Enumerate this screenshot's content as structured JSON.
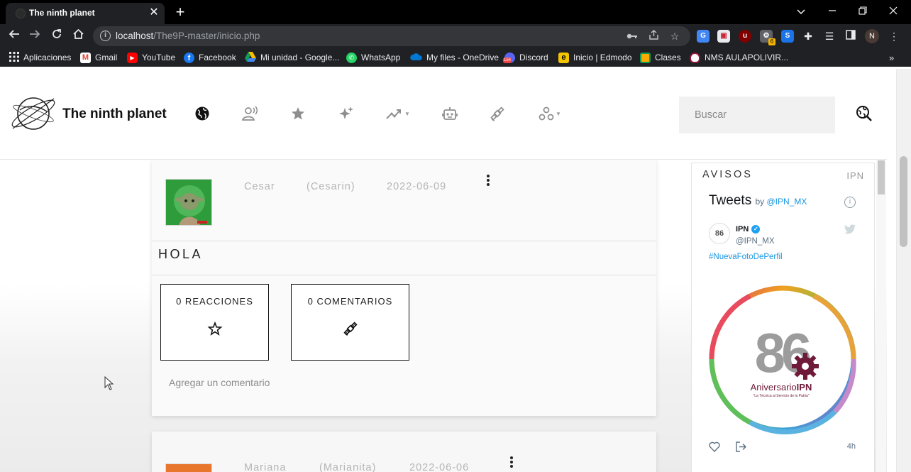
{
  "browser": {
    "tab_title": "The ninth planet",
    "url_host": "localhost",
    "url_path": "/The9P-master/inicio.php",
    "profile_initial": "N",
    "extension_badge": "6",
    "bookmarks": [
      {
        "label": "Aplicaciones",
        "icon": "apps-grid-icon",
        "color": "#e8eaed"
      },
      {
        "label": "Gmail",
        "icon": "gmail-icon",
        "color": "#ea4335"
      },
      {
        "label": "YouTube",
        "icon": "youtube-icon",
        "color": "#ff0000"
      },
      {
        "label": "Facebook",
        "icon": "facebook-icon",
        "color": "#1877f2"
      },
      {
        "label": "Mi unidad - Google...",
        "icon": "google-drive-icon",
        "color": "#fbbc04"
      },
      {
        "label": "WhatsApp",
        "icon": "whatsapp-icon",
        "color": "#25d366"
      },
      {
        "label": "My files - OneDrive",
        "icon": "onedrive-icon",
        "color": "#0078d4"
      },
      {
        "label": "Discord",
        "icon": "discord-icon",
        "color": "#5865f2",
        "badge": "154"
      },
      {
        "label": "Inicio | Edmodo",
        "icon": "edmodo-icon",
        "color": "#f5c400"
      },
      {
        "label": "Clases",
        "icon": "classroom-icon",
        "color": "#f9ab00"
      },
      {
        "label": "NMS AULAPOLIVIR...",
        "icon": "aulapolivirtual-icon",
        "color": "#8b1a3a"
      }
    ]
  },
  "site": {
    "title": "The ninth planet",
    "search_placeholder": "Buscar",
    "nav_icons": [
      "globe-icon",
      "person-voice-icon",
      "star-icon",
      "sparkles-icon",
      "trending-dropdown-icon",
      "robot-icon",
      "satellite-icon",
      "shapes-dropdown-icon"
    ]
  },
  "post": {
    "author_name": "Cesar",
    "author_username": "(Cesarin)",
    "date": "2022-06-09",
    "text": "HOLA",
    "reactions_label": "0 REACCIONES",
    "comments_label": "0 COMENTARIOS",
    "comment_placeholder": "Agregar un comentario"
  },
  "post2": {
    "author_name": "Mariana",
    "author_username": "(Marianita)",
    "date": "2022-06-06"
  },
  "sidebar": {
    "title": "AVISOS",
    "tag": "IPN",
    "twitter": {
      "heading": "Tweets",
      "by_prefix": "by ",
      "by_handle": "@IPN_MX",
      "tweet_name": "IPN",
      "tweet_handle": "@IPN_MX",
      "hashtag": "#NuevaFotoDePerfil",
      "image_number": "86",
      "image_caption": "Aniversario",
      "image_caption_bold": "IPN",
      "image_motto": "\"La Técnica al Servicio de la Patria\"",
      "time": "4h",
      "avatar_text": "86"
    }
  },
  "colors": {
    "chrome_dark": "#202124",
    "tab_bar": "#000000",
    "ipn_maroon": "#6e1a38",
    "twitter_blue": "#1b95e0"
  }
}
